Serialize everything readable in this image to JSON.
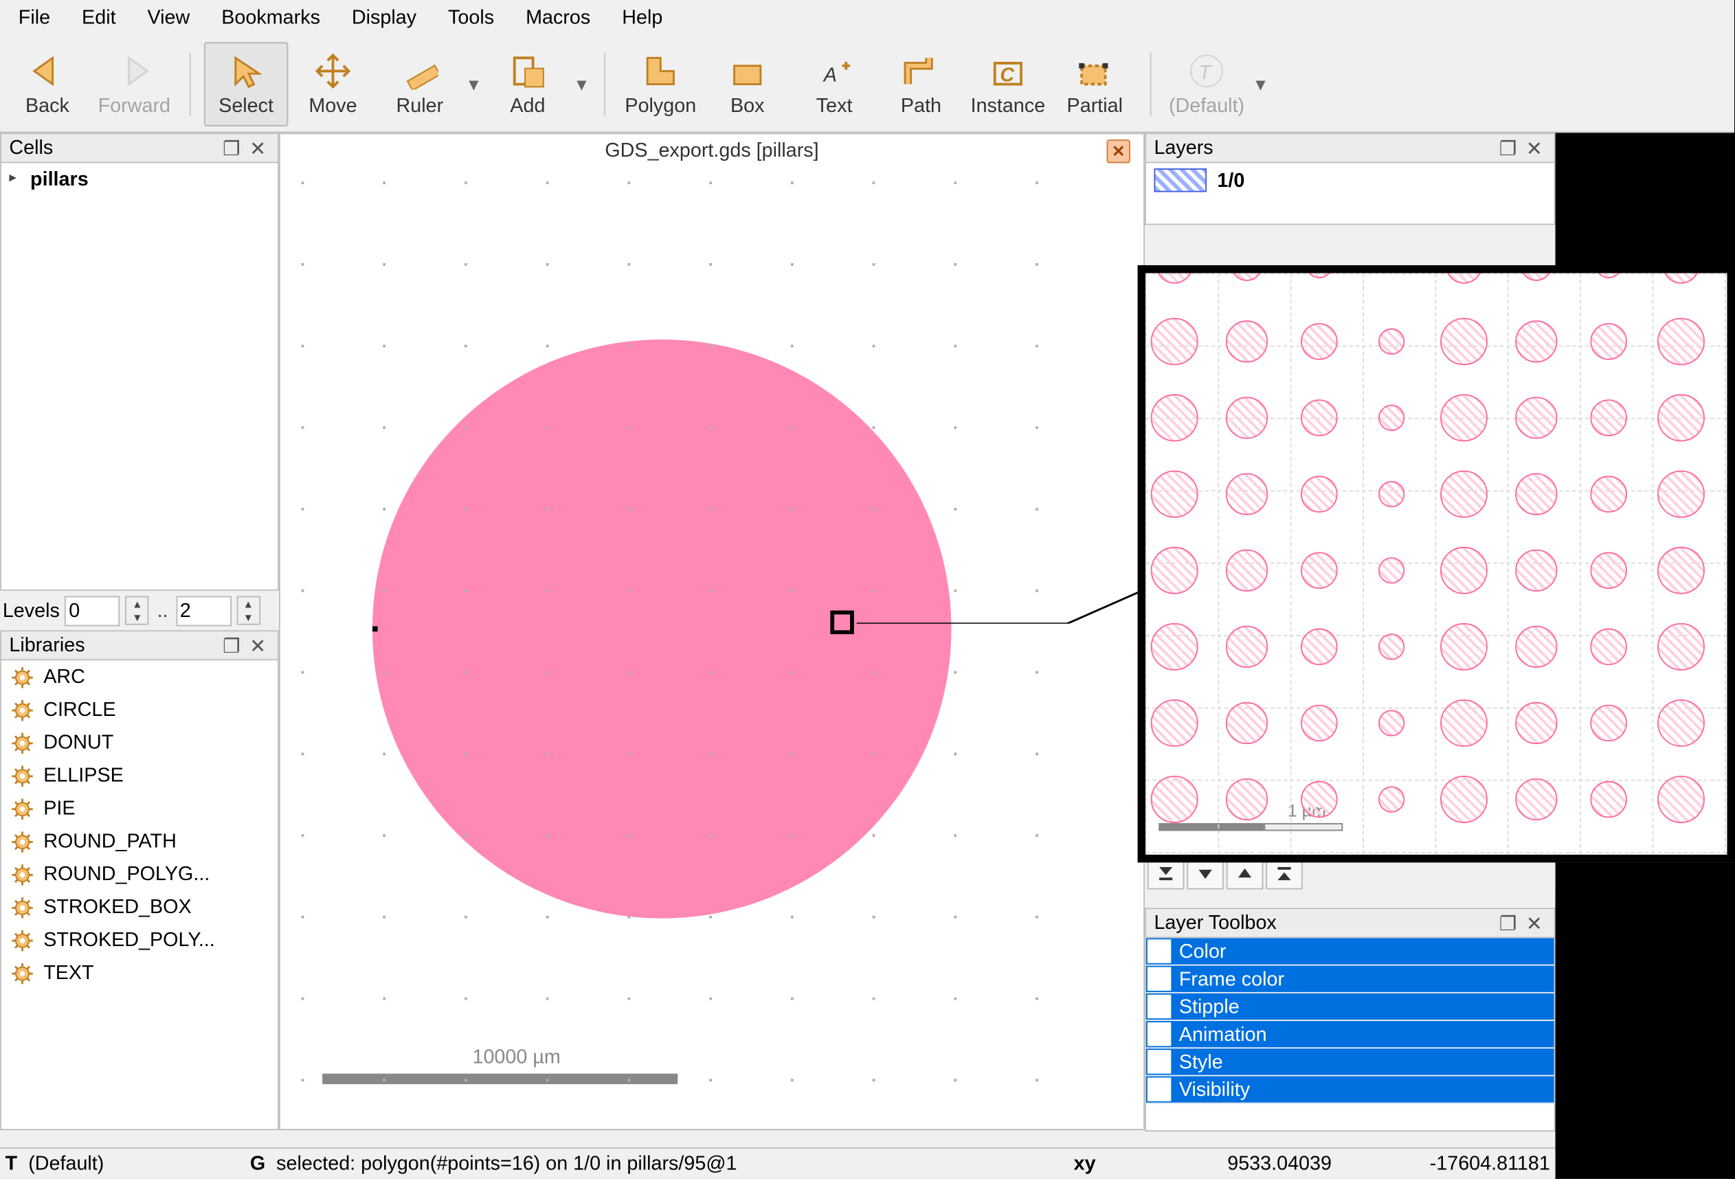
{
  "menu": [
    "File",
    "Edit",
    "View",
    "Bookmarks",
    "Display",
    "Tools",
    "Macros",
    "Help"
  ],
  "toolbar": {
    "back": "Back",
    "forward": "Forward",
    "select": "Select",
    "move": "Move",
    "ruler": "Ruler",
    "add": "Add",
    "polygon": "Polygon",
    "box": "Box",
    "text": "Text",
    "path": "Path",
    "instance": "Instance",
    "partial": "Partial",
    "default": "(Default)"
  },
  "cells": {
    "title": "Cells",
    "items": [
      "pillars"
    ]
  },
  "levels": {
    "label": "Levels",
    "from": "0",
    "to": "2"
  },
  "libraries": {
    "title": "Libraries",
    "items": [
      "ARC",
      "CIRCLE",
      "DONUT",
      "ELLIPSE",
      "PIE",
      "ROUND_PATH",
      "ROUND_POLYG...",
      "STROKED_BOX",
      "STROKED_POLY...",
      "TEXT"
    ]
  },
  "canvas": {
    "title": "GDS_export.gds [pillars]",
    "scale": "10000  µm"
  },
  "layers": {
    "title": "Layers",
    "item": "1/0"
  },
  "layer_toolbox": {
    "title": "Layer Toolbox",
    "rows": [
      "Color",
      "Frame color",
      "Stipple",
      "Animation",
      "Style",
      "Visibility"
    ]
  },
  "zoom": {
    "scale": "1  µm"
  },
  "status": {
    "mode": "T",
    "mode_txt": "(Default)",
    "g": "G",
    "sel": "selected: polygon(#points=16) on 1/0 in pillars/95@1",
    "xy_lbl": "xy",
    "x": "9533.04039",
    "y": "-17604.81181"
  }
}
